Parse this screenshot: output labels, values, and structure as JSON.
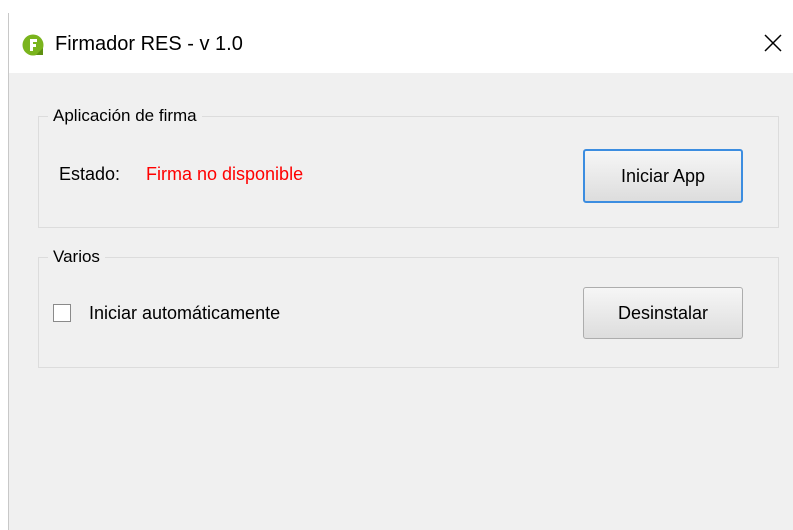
{
  "window": {
    "title": "Firmador RES - v 1.0",
    "icon": "firmador-app-icon",
    "close_icon": "close-icon"
  },
  "signing_group": {
    "legend": "Aplicación de firma",
    "status_label": "Estado:",
    "status_value": "Firma no disponible",
    "status_color": "#ff0000",
    "start_button_label": "Iniciar App"
  },
  "misc_group": {
    "legend": "Varios",
    "autostart_label": "Iniciar automáticamente",
    "autostart_checked": false,
    "uninstall_button_label": "Desinstalar"
  },
  "colors": {
    "icon_green": "#7ab41d",
    "focus_border": "#3c8de0",
    "window_bg": "#f0f0f0"
  }
}
